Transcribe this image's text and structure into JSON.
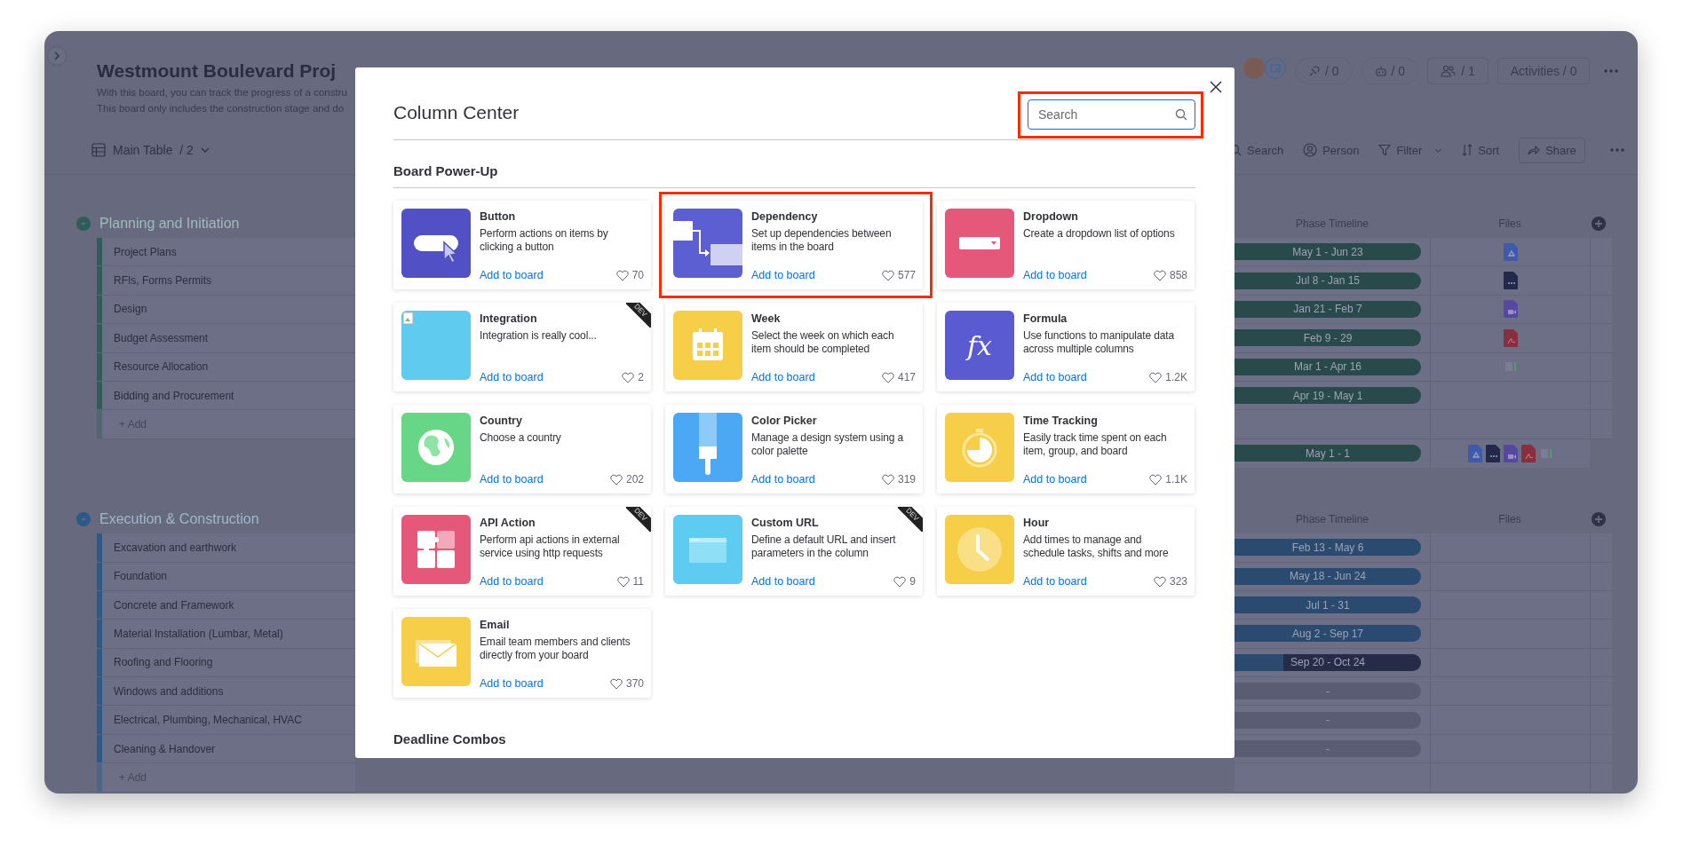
{
  "board": {
    "title": "Westmount Boulevard Proj",
    "description": [
      "With this board, you can track the progress of a constru",
      "This board only includes the construction stage and do"
    ],
    "view": {
      "label": "Main Table",
      "count": "/ 2"
    },
    "header_buttons": [
      {
        "kind": "integrations",
        "label": "/ 0"
      },
      {
        "kind": "automations",
        "label": "/ 0"
      },
      {
        "kind": "members",
        "label": "/ 1"
      },
      {
        "kind": "activities",
        "label": "Activities / 0"
      }
    ],
    "toolbar": [
      {
        "kind": "search",
        "label": "Search"
      },
      {
        "kind": "person",
        "label": "Person"
      },
      {
        "kind": "filter",
        "label": "Filter"
      },
      {
        "kind": "sort",
        "label": "Sort"
      },
      {
        "kind": "share",
        "label": "Share"
      }
    ],
    "groups": [
      {
        "title": "Planning and Initiation",
        "color": "#2f5e59",
        "columns": [
          "Phase Timeline",
          "Files"
        ],
        "add_label": "+ Add",
        "items": [
          {
            "name": "Project Plans",
            "timeline": {
              "kind": "full",
              "label": "May 1 - Jun 23"
            },
            "files": [
              {
                "kind": "drive"
              }
            ]
          },
          {
            "name": "RFIs, Forms Permits",
            "timeline": {
              "kind": "full",
              "label": "Jul 8 - Jan 15"
            },
            "files": [
              {
                "kind": "doc"
              }
            ]
          },
          {
            "name": "Design",
            "timeline": {
              "kind": "full",
              "label": "Jan 21 - Feb 7"
            },
            "files": [
              {
                "kind": "video"
              }
            ]
          },
          {
            "name": "Budget Assessment",
            "timeline": {
              "kind": "full",
              "label": "Feb 9 - 29"
            },
            "files": [
              {
                "kind": "pdf"
              }
            ]
          },
          {
            "name": "Resource Allocation",
            "timeline": {
              "kind": "full",
              "label": "Mar 1 - Apr 16"
            },
            "files": [
              {
                "kind": "sheet"
              }
            ]
          },
          {
            "name": "Bidding and Procurement",
            "timeline": {
              "kind": "full",
              "label": "Apr 19 - May 1"
            }
          }
        ],
        "summary": {
          "timeline": "May 1 - 1",
          "files": [
            {
              "kind": "drive"
            },
            {
              "kind": "doc"
            },
            {
              "kind": "video"
            },
            {
              "kind": "pdf"
            },
            {
              "kind": "sheet"
            }
          ]
        }
      },
      {
        "title": "Execution & Construction",
        "color": "#2c5986",
        "columns": [
          "Phase Timeline",
          "Files"
        ],
        "add_label": "+ Add",
        "items": [
          {
            "name": "Excavation and earthwork",
            "timeline": {
              "kind": "full",
              "label": "Feb 13 - May 6"
            }
          },
          {
            "name": "Foundation",
            "timeline": {
              "kind": "full",
              "label": "May 18 - Jun 24"
            }
          },
          {
            "name": "Concrete and Framework",
            "timeline": {
              "kind": "full",
              "label": "Jul 1 - 31"
            }
          },
          {
            "name": "Material Installation (Lumbar, Metal)",
            "timeline": {
              "kind": "full",
              "label": "Aug 2 - Sep 17"
            }
          },
          {
            "name": "Roofing and Flooring",
            "timeline": {
              "kind": "partial",
              "label": "Sep 20 - Oct 24",
              "level": 0.26
            }
          },
          {
            "name": "Windows and additions",
            "timeline": {
              "kind": "empty",
              "label": "-"
            }
          },
          {
            "name": "Electrical, Plumbing, Mechanical, HVAC",
            "timeline": {
              "kind": "empty",
              "label": "-"
            }
          },
          {
            "name": "Cleaning & Handover",
            "timeline": {
              "kind": "empty",
              "label": "-"
            }
          }
        ]
      }
    ]
  },
  "modal": {
    "title": "Column Center",
    "search": {
      "placeholder": "Search",
      "highlighted": true
    },
    "sections": [
      {
        "title": "Board Power-Up",
        "cards": [
          {
            "kind": "button",
            "name": "Button",
            "description": "Perform actions on items by clicking a button",
            "action": "Add to board",
            "likes": "70",
            "highlighted": false
          },
          {
            "kind": "dependency",
            "name": "Dependency",
            "description": "Set up dependencies between items in the board",
            "action": "Add to board",
            "likes": "577",
            "highlighted": true
          },
          {
            "kind": "dropdown",
            "name": "Dropdown",
            "description": "Create a dropdown list of options",
            "action": "Add to board",
            "likes": "858",
            "highlighted": false
          },
          {
            "kind": "broken",
            "name": "Integration",
            "description": "Integration is really cool...",
            "action": "Add to board",
            "likes": "2",
            "highlighted": false,
            "ribbon": "DEV"
          },
          {
            "kind": "calendar",
            "name": "Week",
            "description": "Select the week on which each item should be completed",
            "action": "Add to board",
            "likes": "417",
            "highlighted": false
          },
          {
            "kind": "formula",
            "glyph": "fx",
            "name": "Formula",
            "description": "Use functions to manipulate data across multiple columns",
            "action": "Add to board",
            "likes": "1.2K",
            "highlighted": false
          },
          {
            "kind": "globe",
            "name": "Country",
            "description": "Choose a country",
            "action": "Add to board",
            "likes": "202",
            "highlighted": false
          },
          {
            "kind": "brush",
            "name": "Color Picker",
            "description": "Manage a design system using a color palette",
            "action": "Add to board",
            "likes": "319",
            "highlighted": false
          },
          {
            "kind": "stopwatch",
            "name": "Time Tracking",
            "description": "Easily track time spent on each item, group, and board",
            "action": "Add to board",
            "likes": "1.1K",
            "highlighted": false
          },
          {
            "kind": "puzzle",
            "name": "API Action",
            "description": "Perform api actions in external service using http requests",
            "action": "Add to board",
            "likes": "11",
            "highlighted": false,
            "ribbon": "DEV"
          },
          {
            "kind": "browser",
            "name": "Custom URL",
            "description": "Define a default URL and insert parameters in the column",
            "action": "Add to board",
            "likes": "9",
            "highlighted": false,
            "ribbon": "DEV"
          },
          {
            "kind": "clock",
            "name": "Hour",
            "description": "Add times to manage and schedule tasks, shifts and more",
            "action": "Add to board",
            "likes": "323",
            "highlighted": false
          },
          {
            "kind": "envelope",
            "name": "Email",
            "description": "Email team members and clients directly from your board",
            "action": "Add to board",
            "likes": "370",
            "highlighted": false
          }
        ]
      },
      {
        "title": "Deadline Combos"
      }
    ]
  }
}
